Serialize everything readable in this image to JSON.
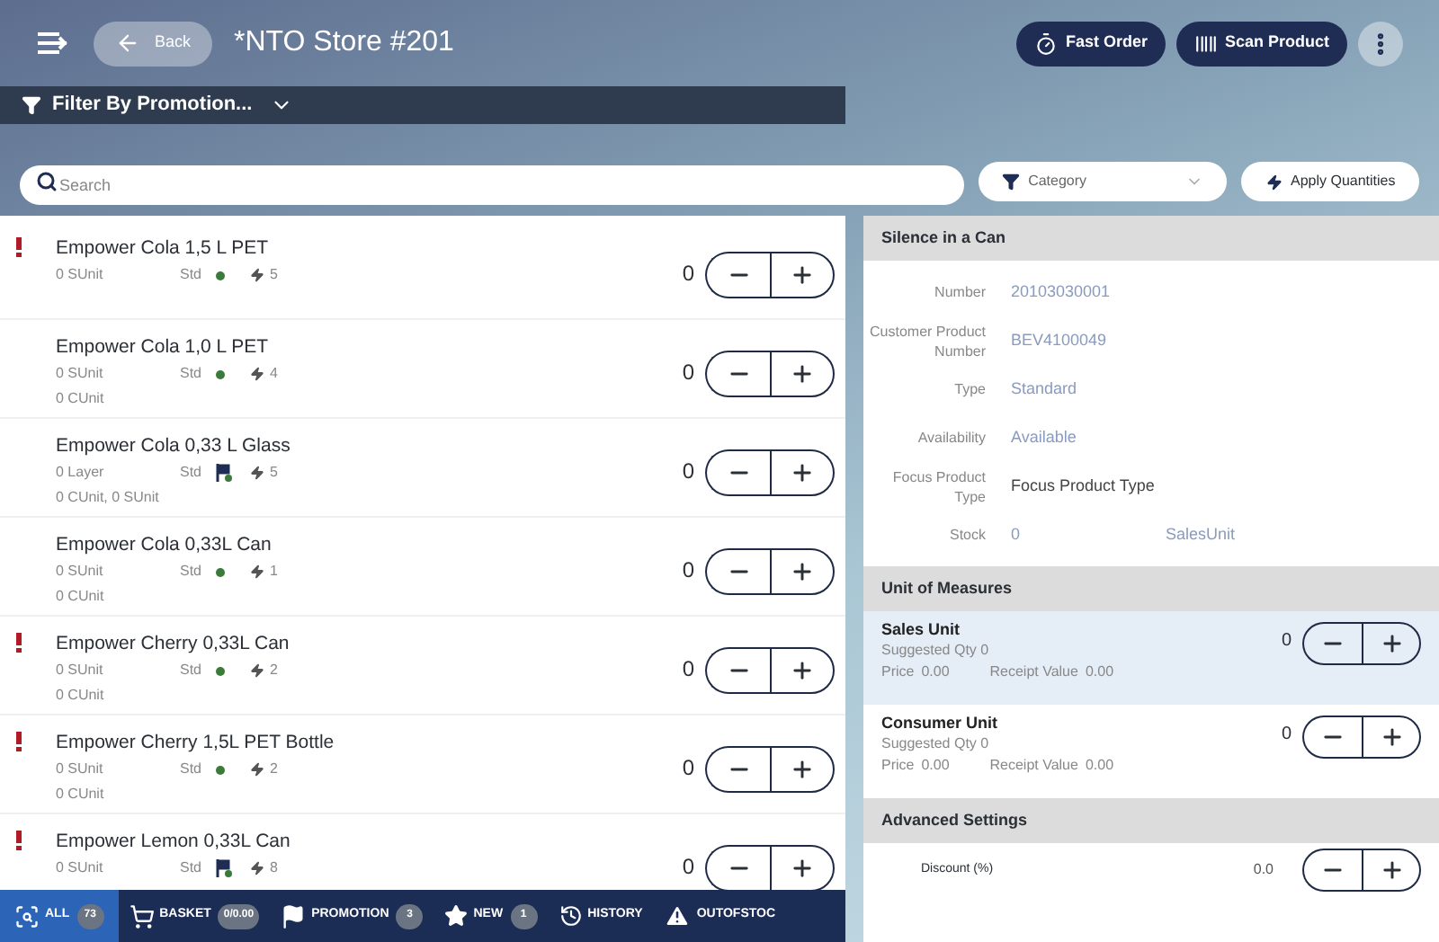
{
  "header": {
    "back_label": "Back",
    "title": "*NTO Store #201",
    "actions": [
      "Fast Order",
      "Scan Product"
    ]
  },
  "filter": {
    "label": "Filter By Promotion..."
  },
  "search": {
    "placeholder": "Search"
  },
  "category": {
    "placeholder": "Category"
  },
  "apply_button": "Apply Quantities",
  "products": [
    {
      "name": "Empower Cola 1,5 L PET",
      "alert": true,
      "unit_lines": [
        "0 SUnit"
      ],
      "type": "Std",
      "kind": "dot",
      "promo_count": "5",
      "quantity": "0"
    },
    {
      "name": "Empower Cola 1,0 L PET",
      "alert": false,
      "unit_lines": [
        "0 SUnit",
        "0 CUnit"
      ],
      "type": "Std",
      "kind": "dot",
      "promo_count": "4",
      "quantity": "0"
    },
    {
      "name": "Empower Cola 0,33 L Glass",
      "alert": false,
      "unit_lines": [
        "0 Layer",
        "0 CUnit, 0 SUnit"
      ],
      "type": "Std",
      "kind": "flag",
      "promo_count": "5",
      "quantity": "0"
    },
    {
      "name": "Empower Cola 0,33L Can",
      "alert": false,
      "unit_lines": [
        "0 SUnit",
        "0 CUnit"
      ],
      "type": "Std",
      "kind": "dot",
      "promo_count": "1",
      "quantity": "0"
    },
    {
      "name": "Empower Cherry 0,33L Can",
      "alert": true,
      "unit_lines": [
        "0 SUnit",
        "0 CUnit"
      ],
      "type": "Std",
      "kind": "dot",
      "promo_count": "2",
      "quantity": "0"
    },
    {
      "name": "Empower Cherry 1,5L PET Bottle",
      "alert": true,
      "unit_lines": [
        "0 SUnit",
        "0 CUnit"
      ],
      "type": "Std",
      "kind": "dot",
      "promo_count": "2",
      "quantity": "0"
    },
    {
      "name": "Empower Lemon 0,33L Can",
      "alert": true,
      "unit_lines": [
        "0 SUnit"
      ],
      "type": "Std",
      "kind": "flag",
      "promo_count": "8",
      "quantity": "0"
    }
  ],
  "detail": {
    "title": "Silence in a Can",
    "fields": [
      {
        "label": "Number",
        "value": "20103030001",
        "kind": "link"
      },
      {
        "label": "Customer Product Number",
        "value": "BEV4100049",
        "kind": "link"
      },
      {
        "label": "Type",
        "value": "Standard",
        "kind": "link"
      },
      {
        "label": "Availability",
        "value": "Available",
        "kind": "link"
      },
      {
        "label": "Focus Product Type",
        "value": "Focus Product Type",
        "kind": "text"
      },
      {
        "label": "Stock",
        "value": "0",
        "unit": "SalesUnit",
        "kind": "link"
      }
    ]
  },
  "units": {
    "title": "Unit of Measures",
    "items": [
      {
        "name": "Sales Unit",
        "suggested": "Suggested Qty 0",
        "price_label": "Price",
        "price": "0.00",
        "receipt_label": "Receipt Value",
        "receipt": "0.00",
        "quantity": "0",
        "selected": true
      },
      {
        "name": "Consumer Unit",
        "suggested": "Suggested Qty 0",
        "price_label": "Price",
        "price": "0.00",
        "receipt_label": "Receipt Value",
        "receipt": "0.00",
        "quantity": "0",
        "selected": false
      }
    ]
  },
  "advanced": {
    "title": "Advanced Settings",
    "items": [
      {
        "label": "Discount (%)",
        "value": "0.0"
      }
    ]
  },
  "nav": [
    {
      "label": "ALL",
      "count": "73",
      "kind": "all",
      "selected": true
    },
    {
      "label": "BASKET",
      "count": "0/0.00",
      "kind": "basket",
      "selected": false
    },
    {
      "label": "PROMOTION",
      "count": "3",
      "kind": "promotion",
      "selected": false
    },
    {
      "label": "NEW",
      "count": "1",
      "kind": "new",
      "selected": false
    },
    {
      "label": "HISTORY",
      "kind": "history",
      "selected": false
    },
    {
      "label": "OUTOFSTOC",
      "kind": "outofstock",
      "selected": false
    }
  ]
}
